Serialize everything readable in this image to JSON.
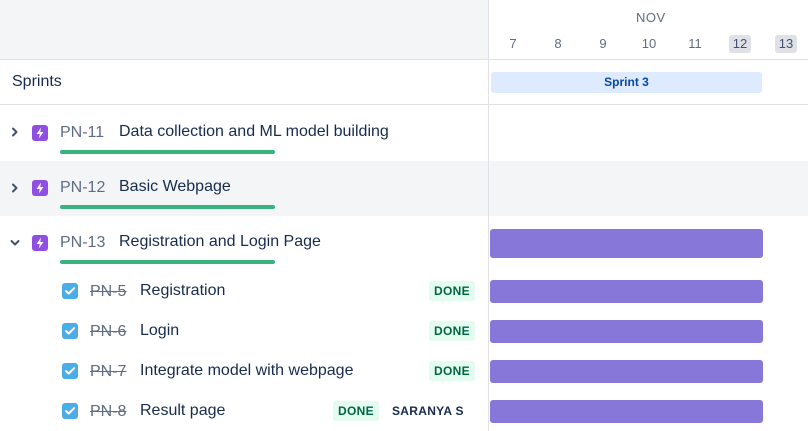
{
  "timeline": {
    "month": "NOV",
    "days": [
      {
        "label": "7",
        "weekend": false
      },
      {
        "label": "8",
        "weekend": false
      },
      {
        "label": "9",
        "weekend": false
      },
      {
        "label": "10",
        "weekend": false
      },
      {
        "label": "11",
        "weekend": false
      },
      {
        "label": "12",
        "weekend": true
      },
      {
        "label": "13",
        "weekend": true
      }
    ]
  },
  "sprints": {
    "title": "Sprints",
    "sprint_label": "Sprint 3"
  },
  "epics": [
    {
      "key": "PN-11",
      "title": "Data collection and ML model building",
      "expanded": false,
      "icon": "epic-lightning-icon"
    },
    {
      "key": "PN-12",
      "title": "Basic Webpage",
      "expanded": false,
      "icon": "epic-lightning-icon"
    },
    {
      "key": "PN-13",
      "title": "Registration and Login Page",
      "expanded": true,
      "icon": "epic-lightning-icon"
    }
  ],
  "issues": [
    {
      "key": "PN-5",
      "title": "Registration",
      "status": "DONE",
      "assignee": ""
    },
    {
      "key": "PN-6",
      "title": "Login",
      "status": "DONE",
      "assignee": ""
    },
    {
      "key": "PN-7",
      "title": "Integrate model with webpage",
      "status": "DONE",
      "assignee": ""
    },
    {
      "key": "PN-8",
      "title": "Result page",
      "status": "DONE",
      "assignee": "SARANYA S"
    }
  ],
  "colors": {
    "epic": "#904ee2",
    "bar": "#8777d9",
    "progress": "#36b37e",
    "checkbox": "#4bade8",
    "sprint_chip": "#deebff",
    "done_badge_bg": "#e3fcef",
    "done_badge_text": "#006644"
  }
}
